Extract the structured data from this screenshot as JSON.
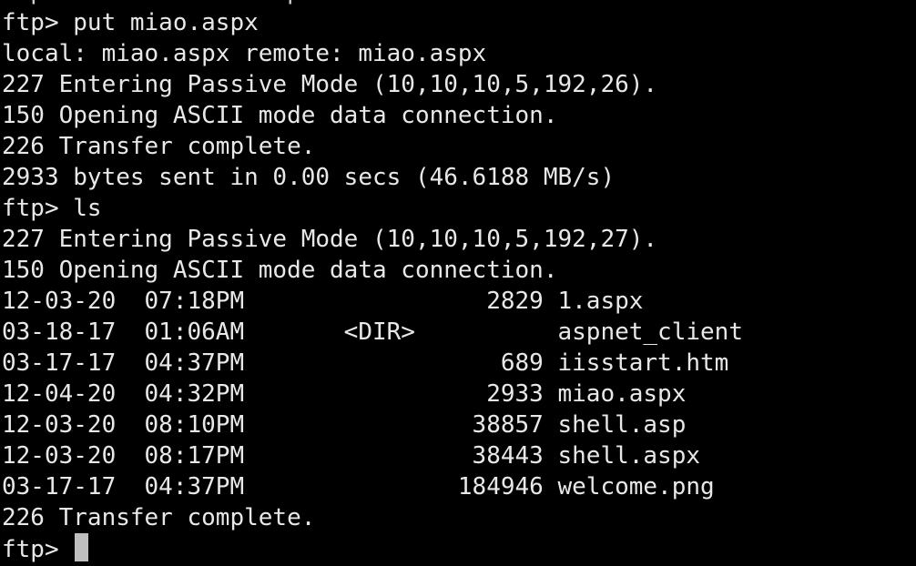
{
  "terminal": {
    "partial_top_line": "ftp> mdelete miao.aspx?",
    "lines": [
      "ftp> put miao.aspx",
      "local: miao.aspx remote: miao.aspx",
      "227 Entering Passive Mode (10,10,10,5,192,26).",
      "150 Opening ASCII mode data connection.",
      "226 Transfer complete.",
      "2933 bytes sent in 0.00 secs (46.6188 MB/s)",
      "ftp> ls",
      "227 Entering Passive Mode (10,10,10,5,192,27).",
      "150 Opening ASCII mode data connection.",
      "12-03-20  07:18PM                 2829 1.aspx",
      "03-18-17  01:06AM       <DIR>          aspnet_client",
      "03-17-17  04:37PM                  689 iisstart.htm",
      "12-04-20  04:32PM                 2933 miao.aspx",
      "12-03-20  08:10PM                38857 shell.asp",
      "12-03-20  08:17PM                38443 shell.aspx",
      "03-17-17  04:37PM               184946 welcome.png",
      "226 Transfer complete."
    ],
    "prompt": "ftp> ",
    "colors": {
      "background": "#000000",
      "text": "#e8e8e8",
      "cursor": "#bfbfbf"
    },
    "cursor_icon": "block-cursor-icon"
  }
}
